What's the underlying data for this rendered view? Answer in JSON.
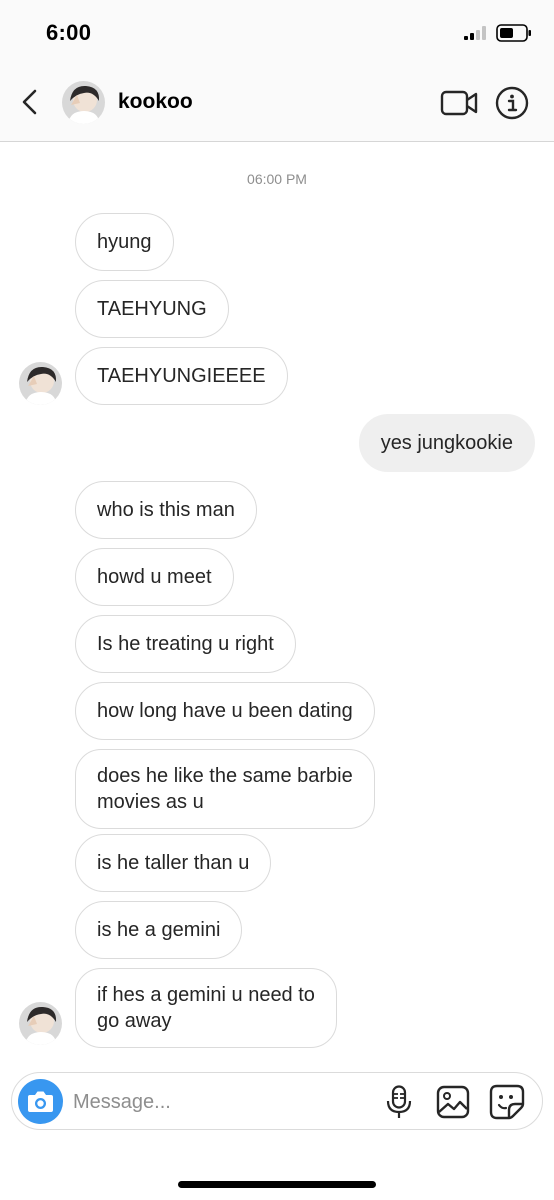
{
  "status_bar": {
    "time": "6:00"
  },
  "header": {
    "username": "kookoo"
  },
  "thread": {
    "timestamp": "06:00 PM",
    "messages": [
      {
        "sender": "them",
        "text": "hyung"
      },
      {
        "sender": "them",
        "text": "TAEHYUNG"
      },
      {
        "sender": "them",
        "text": "TAEHYUNGIEEEE"
      },
      {
        "sender": "me",
        "text": "yes jungkookie"
      },
      {
        "sender": "them",
        "text": "who is this man"
      },
      {
        "sender": "them",
        "text": "howd u meet"
      },
      {
        "sender": "them",
        "text": "Is he treating u right"
      },
      {
        "sender": "them",
        "text": "how long have u been dating"
      },
      {
        "sender": "them",
        "text": "does he like the same barbie\nmovies as u"
      },
      {
        "sender": "them",
        "text": "is he taller than u"
      },
      {
        "sender": "them",
        "text": "is he a gemini"
      },
      {
        "sender": "them",
        "text": "if hes a gemini u need to\ngo away"
      }
    ]
  },
  "composer": {
    "placeholder": "Message..."
  },
  "colors": {
    "accent": "#3897f0",
    "my_bubble": "#efefef",
    "their_bubble_border": "#dbdbdb"
  },
  "icons": [
    "back-icon",
    "video-call-icon",
    "info-icon",
    "camera-icon",
    "microphone-icon",
    "gallery-icon",
    "sticker-icon"
  ]
}
